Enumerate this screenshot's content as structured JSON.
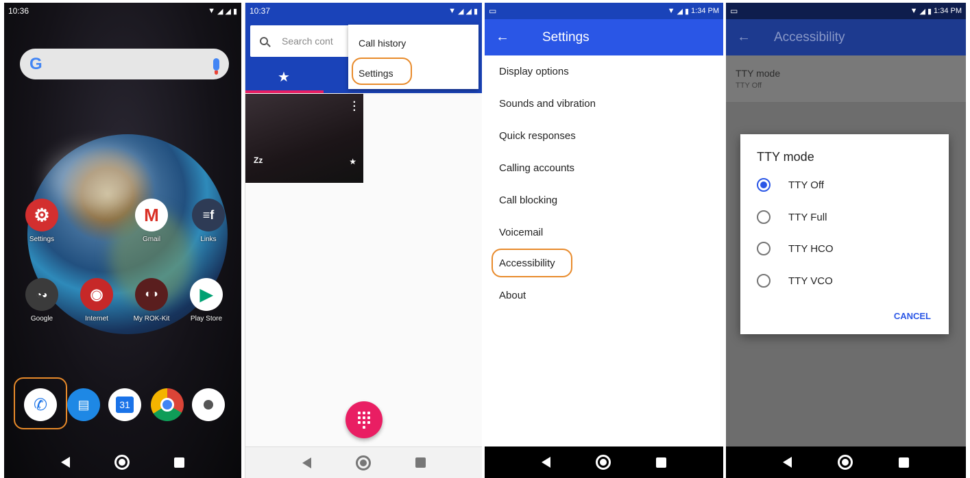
{
  "home": {
    "time": "10:36",
    "google_logo": "G",
    "apps": [
      {
        "label": "Settings"
      },
      {
        "label": "Gmail"
      },
      {
        "label": "Links"
      },
      {
        "label": "Google"
      },
      {
        "label": "Internet"
      },
      {
        "label": "My ROK-Kit"
      },
      {
        "label": "Play Store"
      }
    ],
    "calendar_day": "31"
  },
  "phone": {
    "time": "10:37",
    "search_placeholder": "Search cont",
    "menu": {
      "call_history": "Call history",
      "settings": "Settings"
    },
    "favorite_name": "Zz"
  },
  "settings": {
    "time": "1:34 PM",
    "title": "Settings",
    "items": [
      "Display options",
      "Sounds and vibration",
      "Quick responses",
      "Calling accounts",
      "Call blocking",
      "Voicemail",
      "Accessibility",
      "About"
    ]
  },
  "accessibility": {
    "time": "1:34 PM",
    "title": "Accessibility",
    "tty_label": "TTY mode",
    "tty_value": "TTY Off",
    "dialog": {
      "title": "TTY mode",
      "options": [
        "TTY Off",
        "TTY Full",
        "TTY HCO",
        "TTY VCO"
      ],
      "selected": "TTY Off",
      "cancel": "CANCEL"
    }
  },
  "colors": {
    "highlight": "#e88a2a",
    "primary_blue": "#2a56e6",
    "fab_pink": "#e91e63"
  }
}
